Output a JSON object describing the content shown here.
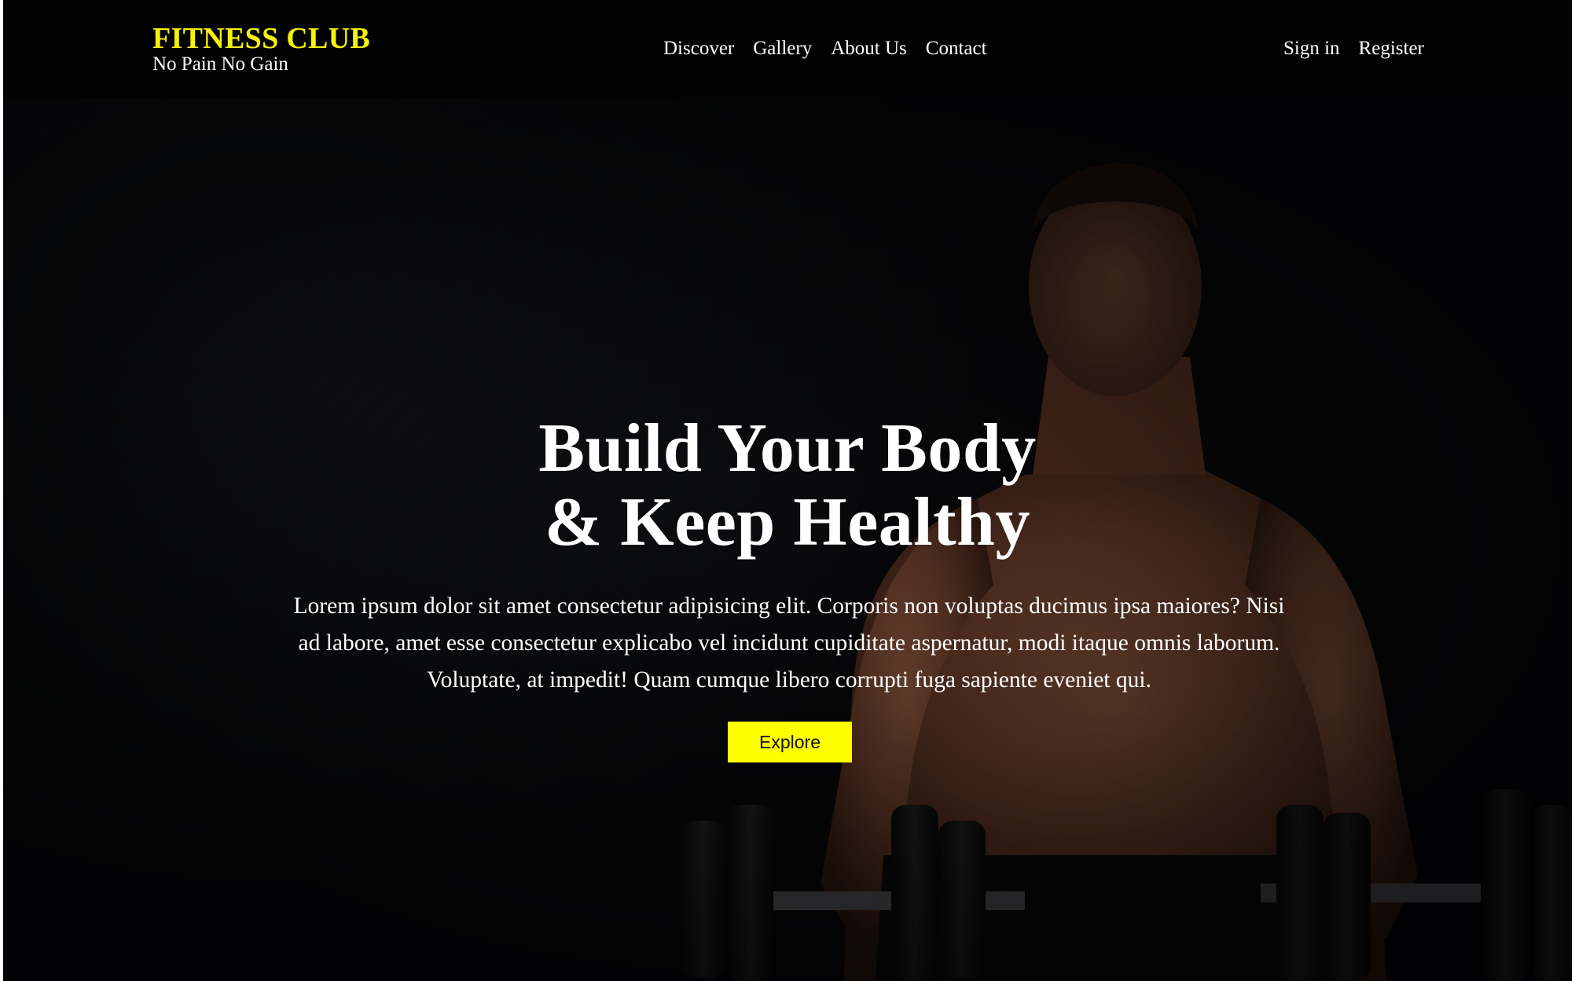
{
  "header": {
    "brand_name": "FITNESS CLUB",
    "tagline": "No Pain No Gain",
    "nav": [
      {
        "label": "Discover"
      },
      {
        "label": "Gallery"
      },
      {
        "label": "About Us"
      },
      {
        "label": "Contact"
      }
    ],
    "auth": {
      "sign_in": "Sign in",
      "register": "Register"
    }
  },
  "hero": {
    "headline_line1": "Build Your Body",
    "headline_line2": "& Keep Healthy",
    "description": "Lorem ipsum dolor sit amet consectetur adipisicing elit. Corporis non voluptas ducimus ipsa maiores? Nisi ad labore, amet esse consectetur explicabo vel incidunt cupiditate aspernatur, modi itaque omnis laborum. Voluptate, at impedit! Quam cumque libero corrupti fuga sapiente eveniet qui.",
    "cta_label": "Explore"
  },
  "colors": {
    "accent": "#ffff00",
    "brand": "#f5f20a",
    "background": "#0b0b0e",
    "header": "#020203"
  }
}
